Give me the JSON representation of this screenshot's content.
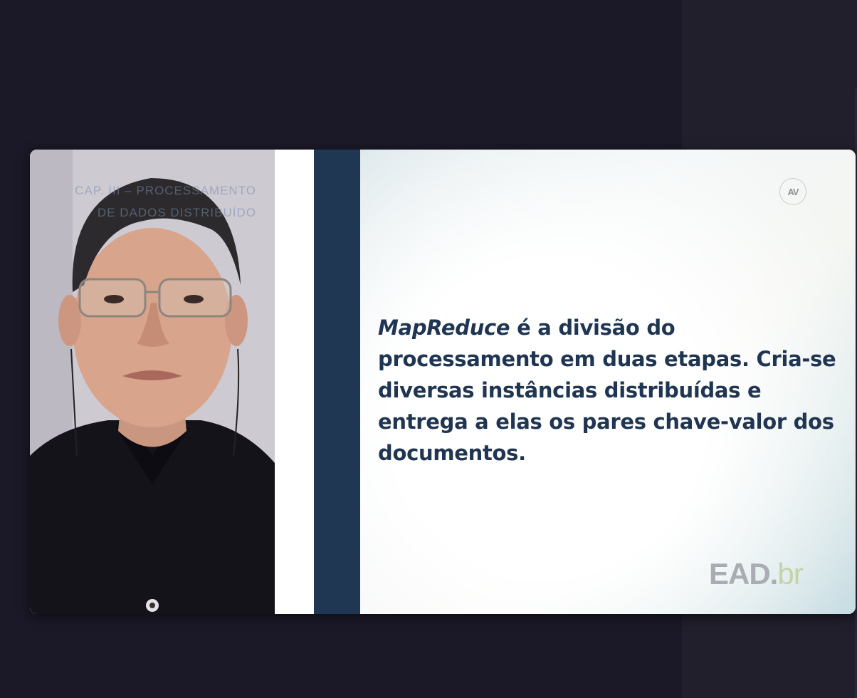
{
  "chapter": {
    "line1": "Cap. III – Processamento",
    "line2": "de dados distribuído"
  },
  "slide": {
    "lead_term": "MapReduce",
    "body": " é a divisão do processamento em duas etapas. Cria-se diversas instâncias distribuídas e entrega a elas os pares chave-valor dos documentos.",
    "corner_logo": "AV",
    "brand": {
      "main": "EAD.",
      "suffix": "br"
    }
  },
  "colors": {
    "background": "#1b1927",
    "navy": "#203753",
    "text": "#1f3552"
  },
  "icons": {
    "presenter": "presenter-video",
    "corner_logo": "av-logo-icon"
  }
}
